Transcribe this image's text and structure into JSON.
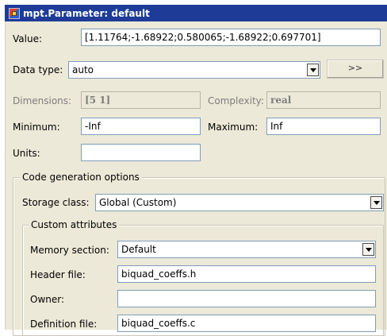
{
  "window": {
    "title": "mpt.Parameter: default"
  },
  "value": {
    "label": "Value:",
    "text": "[1.11764;-1.68922;0.580065;-1.68922;0.697701]"
  },
  "data_type": {
    "label": "Data type:",
    "selected": "auto",
    "button_label": ">>"
  },
  "dimensions": {
    "label": "Dimensions:",
    "value": "[5 1]"
  },
  "complexity": {
    "label": "Complexity:",
    "value": "real"
  },
  "minimum": {
    "label": "Minimum:",
    "value": "-Inf"
  },
  "maximum": {
    "label": "Maximum:",
    "value": "Inf"
  },
  "units": {
    "label": "Units:",
    "value": ""
  },
  "code_generation": {
    "legend": "Code generation options",
    "storage_class_label": "Storage class:",
    "storage_class_value": "Global (Custom)",
    "custom_attributes": {
      "legend": "Custom attributes",
      "memory_section_label": "Memory section:",
      "memory_section_value": "Default",
      "header_file_label": "Header file:",
      "header_file_value": "biquad_coeffs.h",
      "owner_label": "Owner:",
      "owner_value": "",
      "definition_file_label": "Definition file:",
      "definition_file_value": "biquad_coeffs.c"
    }
  }
}
